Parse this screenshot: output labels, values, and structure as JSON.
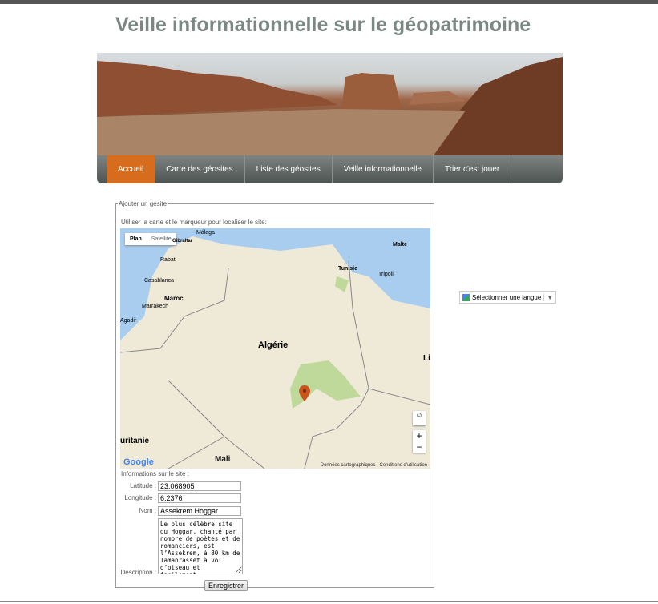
{
  "header": {
    "title": "Veille informationnelle sur le géopatrimoine"
  },
  "nav": [
    "Accueil",
    "Carte des géosites",
    "Liste des géosites",
    "Veille informationnelle",
    "Trier c'est jouer"
  ],
  "form": {
    "legend": "Ajouter un gésite",
    "hint": "Utiliser la carte et le marqueur pour localiser le site:",
    "map": {
      "type_buttons": [
        "Plan",
        "Satellite"
      ],
      "labels": [
        "Málaga",
        "Gibraltar",
        "Rabat",
        "Casablanca",
        "Marrakech",
        "Agadir",
        "Maroc",
        "Algérie",
        "Tunisie",
        "Tripoli",
        "Malte",
        "uritanie",
        "Mali",
        "Li"
      ],
      "zoom_in": "+",
      "zoom_out": "−",
      "logo": "Google",
      "attribution": [
        "Données cartographiques",
        "Conditions d'utilisation"
      ]
    },
    "info_title": "Informations sur le site :",
    "latitude_label": "Latitude :",
    "latitude": "23.068905",
    "longitude_label": "Longitude :",
    "longitude": "6.2376",
    "nom_label": "Nom :",
    "nom": "Assekrem Hoggar",
    "description_label": "Description :",
    "description": "Le plus célèbre site du Hoggar, chanté par nombre de poètes et de romanciers, est l’Assekrem, à 80 km de Tamanrasset à vol d’oiseau et facilement...",
    "submit": "Enregistrer"
  },
  "language": {
    "label": "Sélectionner une langue",
    "arrow": "▼"
  }
}
